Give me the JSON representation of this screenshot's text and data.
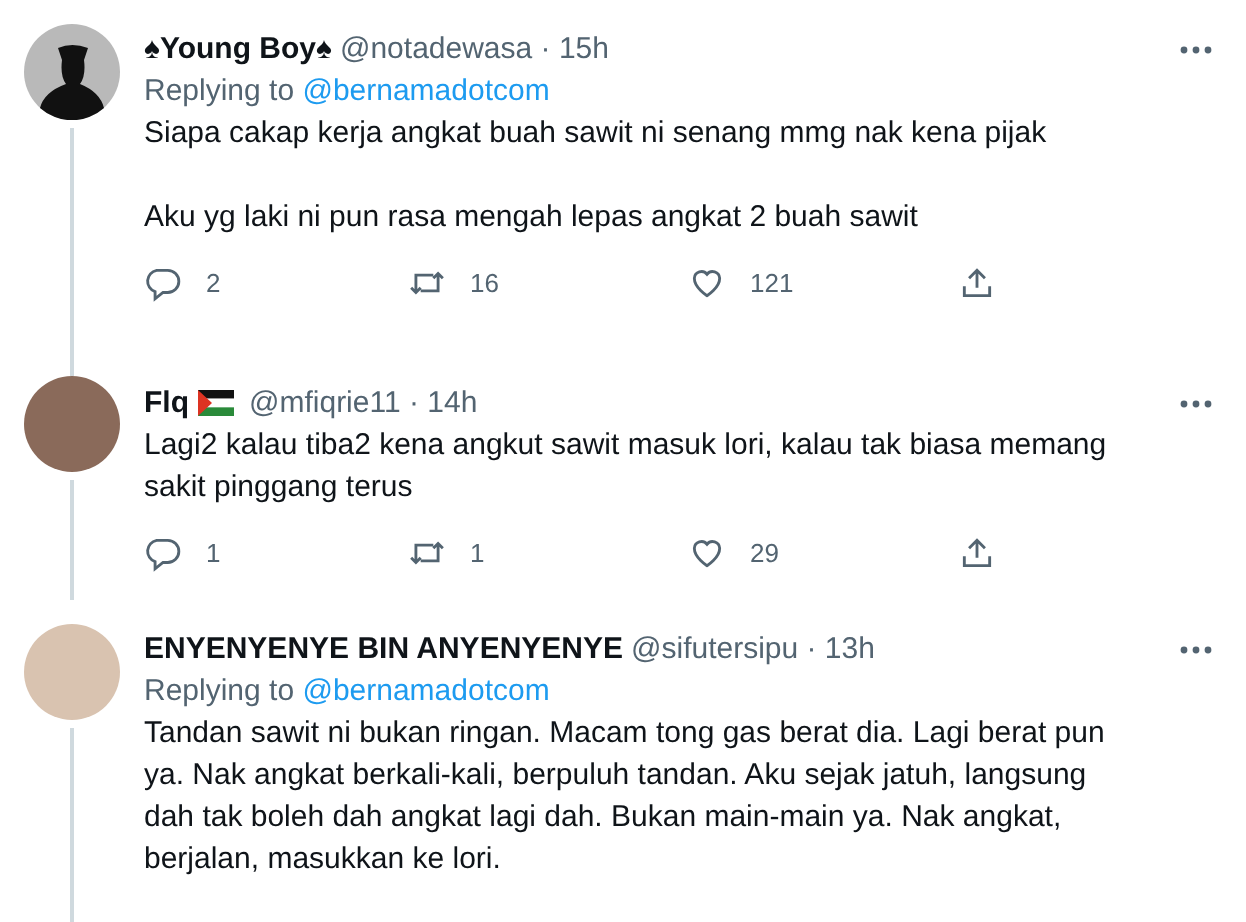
{
  "tweets": [
    {
      "name": "♠Young Boy♠",
      "flag": false,
      "meta": "@notadewasa · 15h",
      "replying_label": "Replying to",
      "replying_to": "@bernamadotcom",
      "paragraphs": [
        "Siapa cakap kerja angkat buah sawit ni senang mmg nak kena pijak",
        "Aku yg laki ni pun rasa mengah lepas angkat 2 buah sawit"
      ],
      "thread_above": false,
      "thread_below": true,
      "kind": "silhouette",
      "counts": {
        "replies": "2",
        "retweets": "16",
        "likes": "121"
      }
    },
    {
      "name": "Flq",
      "flag": true,
      "meta": "@mfiqrie11 · 14h",
      "paragraphs": [
        "Lagi2 kalau tiba2 kena angkut sawit masuk lori, kalau tak biasa memang sakit pinggang terus"
      ],
      "thread_above": true,
      "thread_below": true,
      "kind": "photo",
      "counts": {
        "replies": "1",
        "retweets": "1",
        "likes": "29"
      }
    },
    {
      "name": "ENYENYENYE BIN ANYENYENYE",
      "flag": false,
      "meta": "@sifutersipu · 13h",
      "replying_label": "Replying to",
      "replying_to": "@bernamadotcom",
      "paragraphs": [
        "Tandan sawit ni bukan ringan. Macam tong gas berat dia. Lagi berat pun ya. Nak angkat berkali-kali, berpuluh tandan. Aku sejak jatuh, langsung dah tak boleh dah angkat lagi dah. Bukan main-main ya. Nak angkat, berjalan, masukkan ke lori."
      ],
      "thread_above": false,
      "thread_below": true,
      "kind": "photo"
    }
  ]
}
